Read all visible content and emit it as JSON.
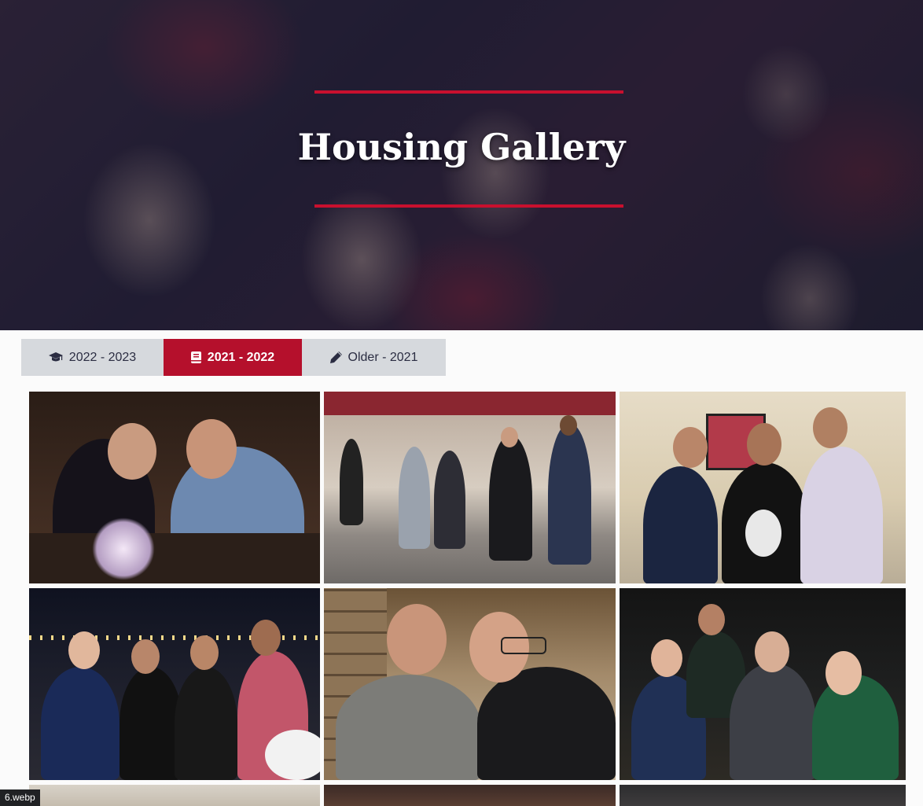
{
  "hero": {
    "title": "Housing Gallery"
  },
  "tabs": [
    {
      "label": "2022 - 2023",
      "icon": "graduation-cap-icon",
      "active": false
    },
    {
      "label": "2021 - 2022",
      "icon": "book-icon",
      "active": true
    },
    {
      "label": "Older - 2021",
      "icon": "pencil-icon",
      "active": false
    }
  ],
  "colors": {
    "accent": "#c8102e",
    "active_tab": "#b5102c",
    "tab_bg": "#d6d9dd",
    "tab_text": "#2b2d42"
  },
  "status": {
    "file_label": "6.webp"
  }
}
